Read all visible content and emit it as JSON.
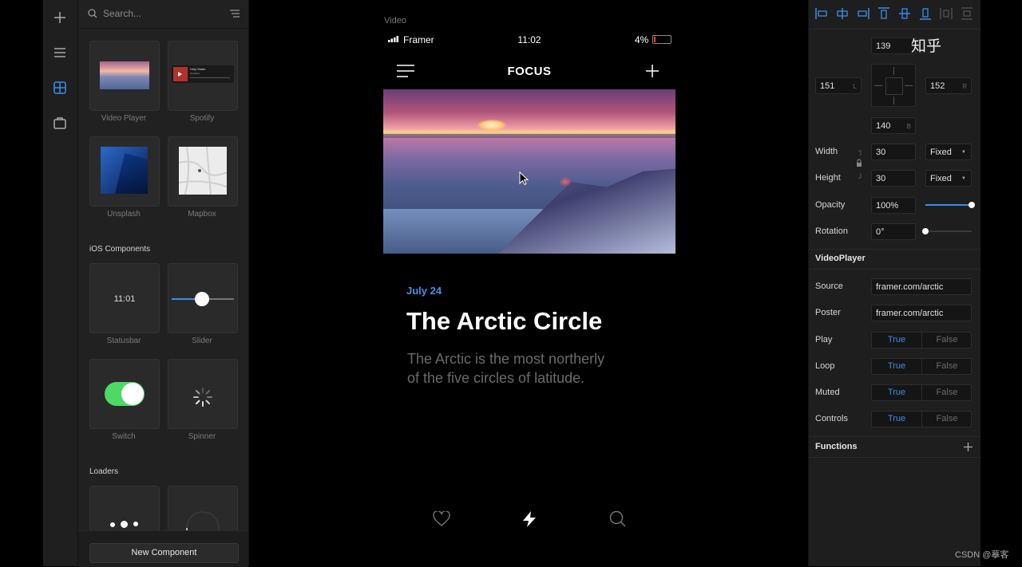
{
  "library": {
    "search_placeholder": "Search...",
    "tiles_top": [
      {
        "label": "Video Player"
      },
      {
        "label": "Spotify",
        "track": "Holy Water",
        "artist": "Hardwell"
      },
      {
        "label": "Unsplash"
      },
      {
        "label": "Mapbox"
      }
    ],
    "ios_title": "iOS Components",
    "ios_tiles": [
      {
        "label": "Statusbar",
        "preview": "11:01"
      },
      {
        "label": "Slider"
      },
      {
        "label": "Switch"
      },
      {
        "label": "Spinner"
      }
    ],
    "loaders_title": "Loaders",
    "new_component": "New Component"
  },
  "canvas": {
    "frame_label": "Video",
    "statusbar": {
      "carrier": "Framer",
      "time": "11:02",
      "battery": "4%"
    },
    "app_title": "FOCUS",
    "article": {
      "date": "July 24",
      "title": "The Arctic Circle",
      "body_line1": "The Arctic is the most northerly",
      "body_line2": "of the five circles of latitude."
    }
  },
  "inspector": {
    "brand": "知乎",
    "top": "139",
    "left": "151",
    "left_tag": "L",
    "right": "152",
    "right_tag": "R",
    "bottom": "140",
    "bottom_tag": "B",
    "width_label": "Width",
    "width_value": "30",
    "width_mode": "Fixed",
    "height_label": "Height",
    "height_value": "30",
    "height_mode": "Fixed",
    "opacity_label": "Opacity",
    "opacity_value": "100%",
    "opacity_level": 1.0,
    "rotation_label": "Rotation",
    "rotation_value": "0°",
    "rotation_level": 0.0,
    "component_title": "VideoPlayer",
    "source_label": "Source",
    "source_value": "framer.com/arctic",
    "poster_label": "Poster",
    "poster_value": "framer.com/arctic",
    "true_label": "True",
    "false_label": "False",
    "play_label": "Play",
    "loop_label": "Loop",
    "muted_label": "Muted",
    "controls_label": "Controls",
    "functions_title": "Functions"
  },
  "watermark": "CSDN @摹客",
  "colors": {
    "accent": "#3a8ee6",
    "switch_green": "#4cd964",
    "date_blue": "#4a90e2"
  }
}
